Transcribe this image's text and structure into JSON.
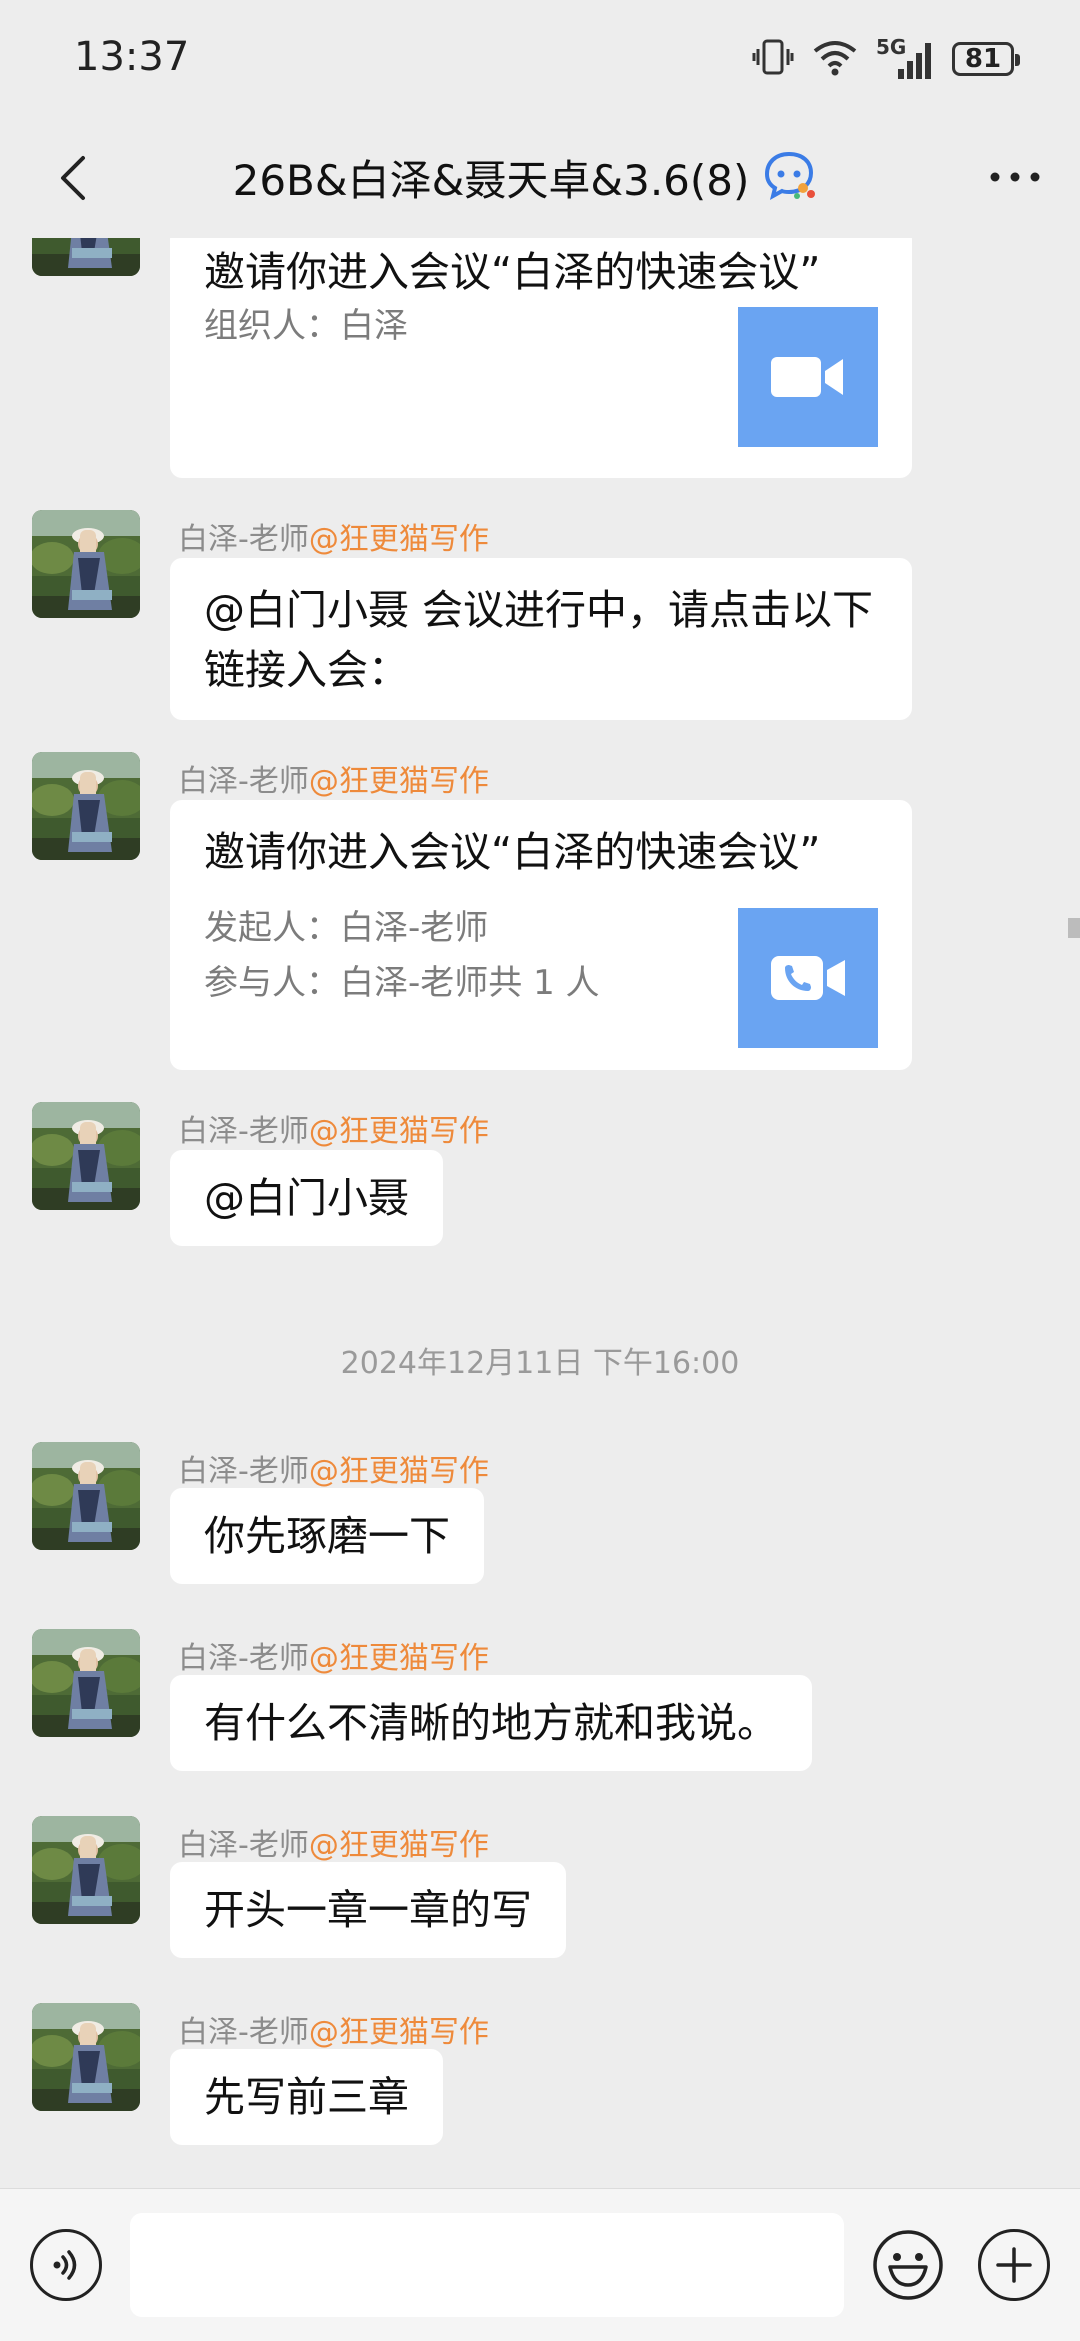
{
  "status_bar": {
    "time": "13:37",
    "network": "5G",
    "battery": "81",
    "icons": [
      "vibrate-icon",
      "wifi-icon",
      "signal-icon",
      "battery-icon"
    ]
  },
  "nav": {
    "title": "26B&白泽&聂天卓&3.6(8)",
    "icons": [
      "back-icon",
      "chat-badge-icon",
      "more-icon"
    ]
  },
  "messages": [
    {
      "type": "meeting_card",
      "title": "邀请你进入会议“白泽的快速会议”",
      "lines": [
        "组织人：白泽"
      ],
      "icon": "video-camera-icon"
    },
    {
      "type": "text",
      "sender": "白泽-老师",
      "sender_tag": "@狂更猫写作",
      "text": "@白门小聂 会议进行中，请点击以下链接入会："
    },
    {
      "type": "meeting_card",
      "sender": "白泽-老师",
      "sender_tag": "@狂更猫写作",
      "title": "邀请你进入会议“白泽的快速会议”",
      "lines": [
        "发起人：白泽-老师",
        "参与人：白泽-老师共 1 人"
      ],
      "icon": "phone-call-icon"
    },
    {
      "type": "text",
      "sender": "白泽-老师",
      "sender_tag": "@狂更猫写作",
      "text": "@白门小聂"
    },
    {
      "type": "timestamp",
      "text": "2024年12月11日 下午16:00"
    },
    {
      "type": "text",
      "sender": "白泽-老师",
      "sender_tag": "@狂更猫写作",
      "text": "你先琢磨一下"
    },
    {
      "type": "text",
      "sender": "白泽-老师",
      "sender_tag": "@狂更猫写作",
      "text": "有什么不清晰的地方就和我说。"
    },
    {
      "type": "text",
      "sender": "白泽-老师",
      "sender_tag": "@狂更猫写作",
      "text": "开头一章一章的写"
    },
    {
      "type": "text",
      "sender": "白泽-老师",
      "sender_tag": "@狂更猫写作",
      "text": "先写前三章"
    }
  ],
  "input_bar": {
    "placeholder": "",
    "icons": [
      "voice-icon",
      "emoji-icon",
      "plus-icon"
    ]
  },
  "colors": {
    "background": "#ededed",
    "bubble": "#ffffff",
    "sender_tag": "#ee8a3b",
    "meeting_icon_bg": "#6aa4f2",
    "meta_text": "#8c8c8c"
  }
}
